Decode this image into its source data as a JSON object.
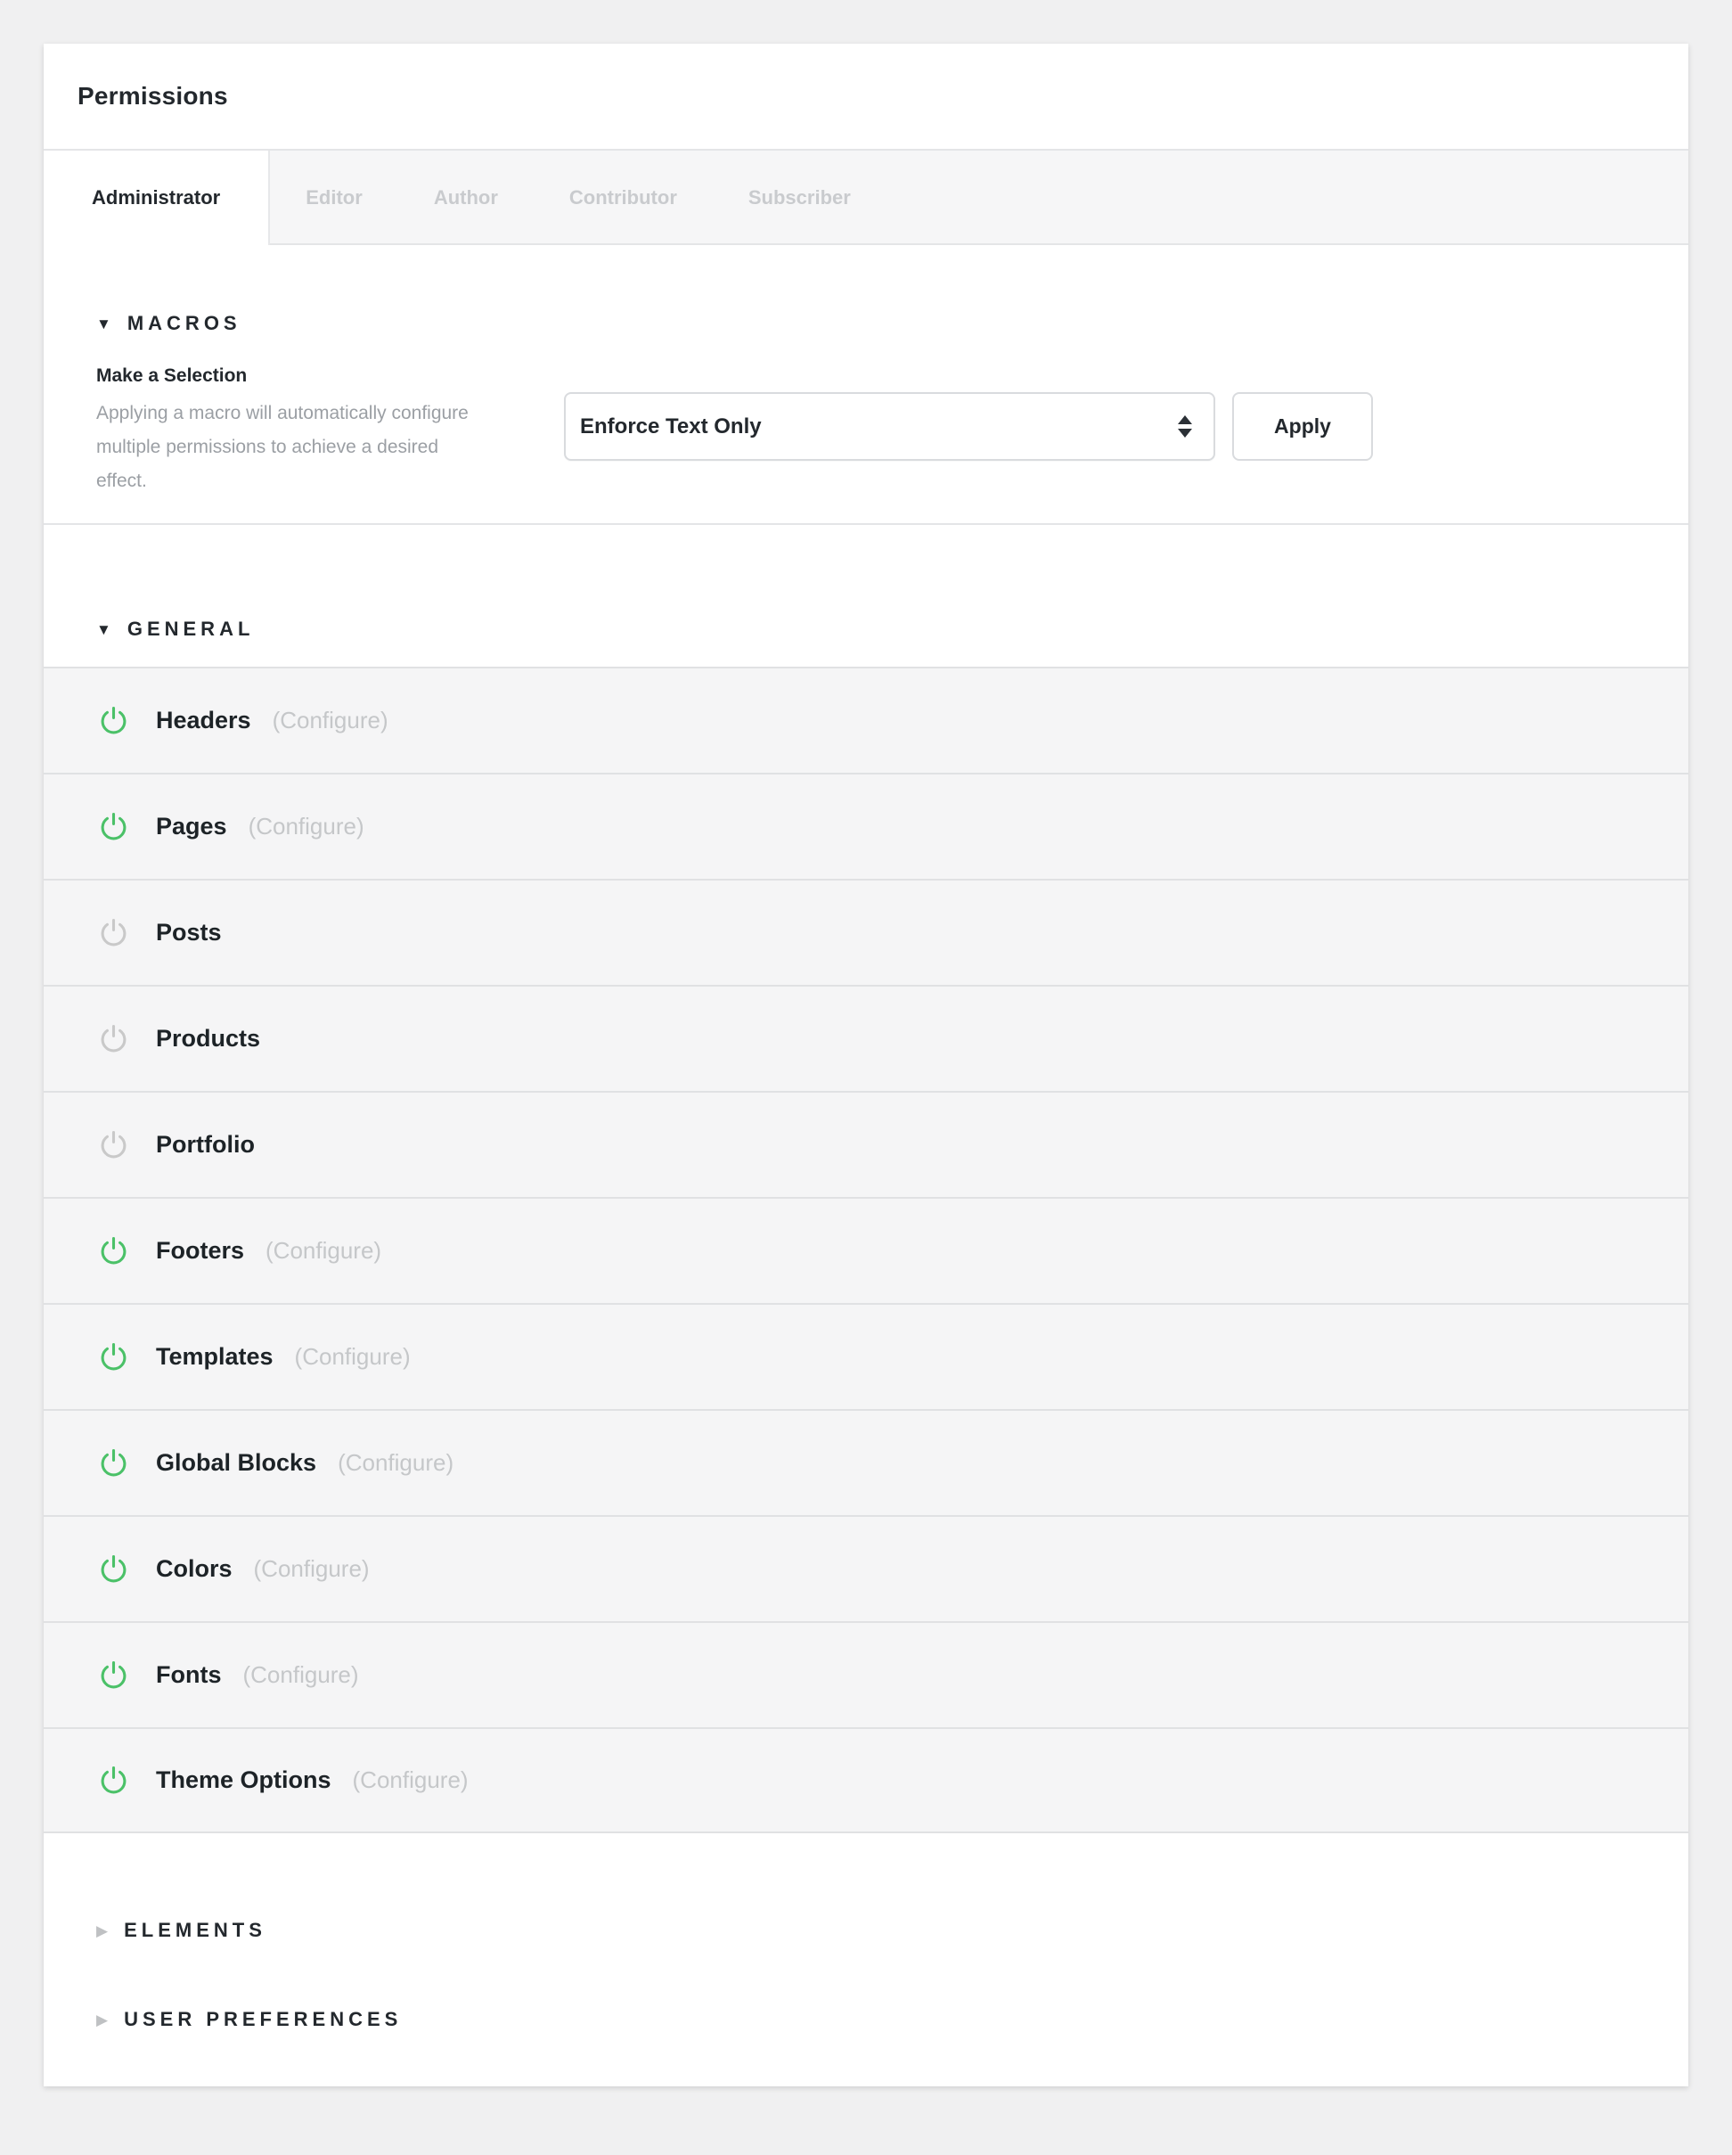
{
  "title": "Permissions",
  "tabs": {
    "active": "Administrator",
    "items": [
      "Administrator",
      "Editor",
      "Author",
      "Contributor",
      "Subscriber"
    ]
  },
  "macros": {
    "heading": "MACROS",
    "selection_label": "Make a Selection",
    "description": "Applying a macro will automatically configure multiple permissions to achieve a desired effect.",
    "selected_option": "Enforce Text Only",
    "apply_label": "Apply"
  },
  "general": {
    "heading": "GENERAL",
    "configure_label": "(Configure)",
    "rows": [
      {
        "label": "Headers",
        "enabled": true,
        "configurable": true
      },
      {
        "label": "Pages",
        "enabled": true,
        "configurable": true
      },
      {
        "label": "Posts",
        "enabled": false,
        "configurable": false
      },
      {
        "label": "Products",
        "enabled": false,
        "configurable": false
      },
      {
        "label": "Portfolio",
        "enabled": false,
        "configurable": false
      },
      {
        "label": "Footers",
        "enabled": true,
        "configurable": true
      },
      {
        "label": "Templates",
        "enabled": true,
        "configurable": true
      },
      {
        "label": "Global Blocks",
        "enabled": true,
        "configurable": true
      },
      {
        "label": "Colors",
        "enabled": true,
        "configurable": true
      },
      {
        "label": "Fonts",
        "enabled": true,
        "configurable": true
      },
      {
        "label": "Theme Options",
        "enabled": true,
        "configurable": true
      }
    ]
  },
  "collapsed_sections": [
    "ELEMENTS",
    "USER PREFERENCES"
  ],
  "glyphs": {
    "expanded_triangle": "▼",
    "collapsed_triangle": "▶"
  },
  "colors": {
    "enabled_icon": "#4bc168",
    "disabled_icon": "#c9c9c9"
  }
}
